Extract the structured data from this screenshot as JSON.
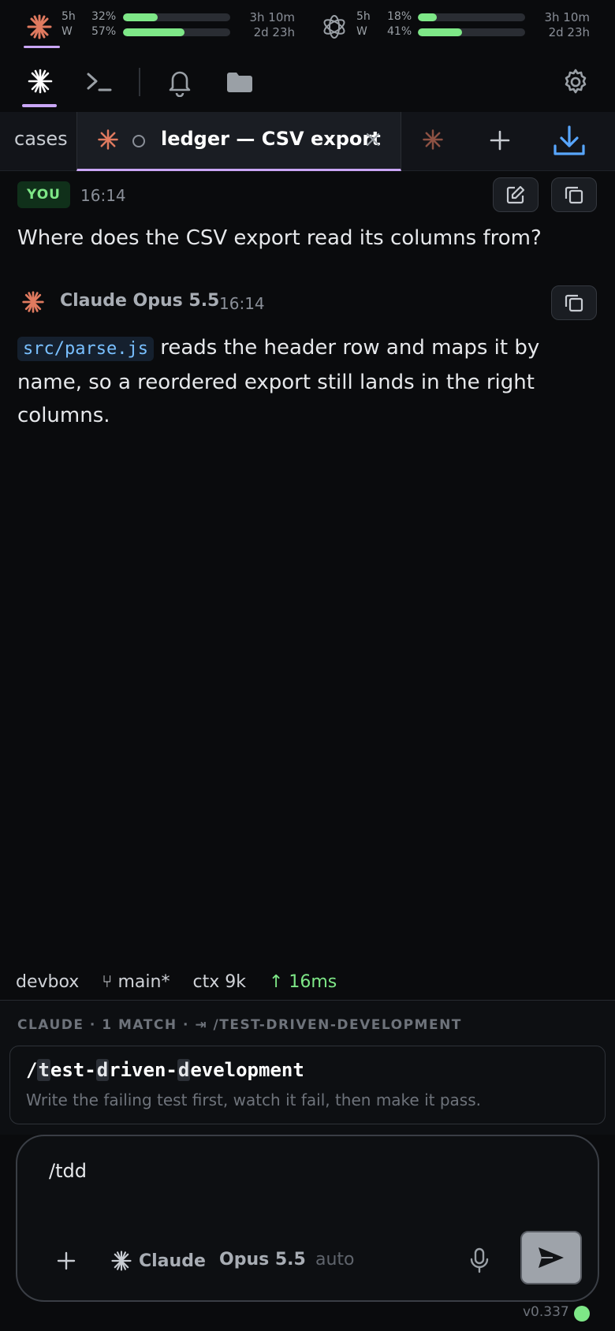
{
  "usage": {
    "claude": {
      "short_label": "5h",
      "short_pct": "32%",
      "short_fill": 0.32,
      "short_time": "3h 10m",
      "week_label": "W",
      "week_pct": "57%",
      "week_fill": 0.57,
      "week_time": "2d 23h"
    },
    "openai": {
      "short_label": "5h",
      "short_pct": "18%",
      "short_fill": 0.18,
      "short_time": "3h 10m",
      "week_label": "W",
      "week_pct": "41%",
      "week_fill": 0.41,
      "week_time": "2d 23h"
    }
  },
  "tabs": {
    "left_partial": "cases",
    "active_title": "ledger — CSV export",
    "right_partial": "("
  },
  "conversation": {
    "user": {
      "badge": "YOU",
      "time": "16:14",
      "text": "Where does the CSV export read its columns from?"
    },
    "assistant": {
      "name": "Claude Opus 5.5",
      "time": "16:14",
      "code": "src/parse.js",
      "text": " reads the header row and maps it by name, so a reordered export still lands in the right columns."
    }
  },
  "status_bar": {
    "host": "devbox",
    "branch": "main*",
    "ctx": "ctx 9k",
    "latency": "↑ 16ms"
  },
  "palette": {
    "header": "CLAUDE · 1 MATCH · ⇥ /TEST-DRIVEN-DEVELOPMENT",
    "command_parts": [
      "/",
      "t",
      "est-",
      "d",
      "riven-",
      "d",
      "evelopment"
    ],
    "description": "Write the failing test first, watch it fail, then make it pass."
  },
  "composer": {
    "input_value": "/tdd",
    "agent_label": "Claude",
    "model_label": "Opus 5.5",
    "mode_label": "auto"
  },
  "footer": {
    "version": "v0.337"
  },
  "colors": {
    "accent_green": "#7ee787",
    "claude_orange": "#e07a5f",
    "tab_underline": "#c9a6f5",
    "download_blue": "#58a6ff"
  }
}
